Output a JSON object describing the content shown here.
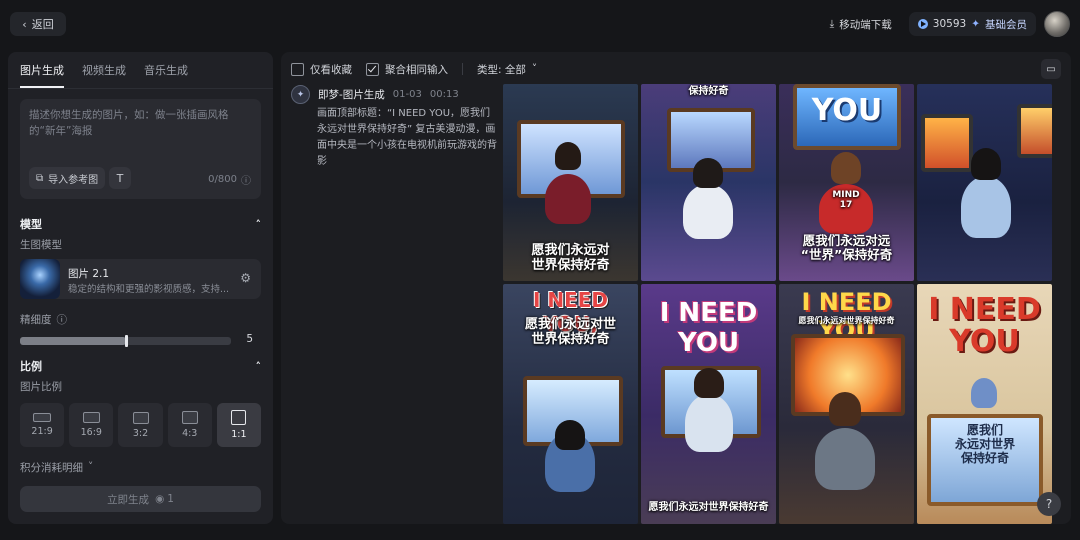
{
  "header": {
    "back_label": "返回",
    "mobile_download": "移动端下载",
    "credits": "30593",
    "membership": "基础会员"
  },
  "left": {
    "tabs": [
      {
        "label": "图片生成",
        "active": true
      },
      {
        "label": "视频生成",
        "active": false
      },
      {
        "label": "音乐生成",
        "active": false
      }
    ],
    "prompt_placeholder": "描述你想生成的图片，如：做一张插画风格的“新年”海报",
    "import_ref": "导入参考图",
    "char_count": "0/800",
    "model_section": "模型",
    "model_sub": "生图模型",
    "model_name": "图片 2.1",
    "model_desc": "稳定的结构和更强的影视质感，支持...",
    "detail_label": "精细度",
    "detail_value": "5",
    "detail_fraction": 0.5,
    "ratio_section": "比例",
    "ratio_sub": "图片比例",
    "ratios": [
      {
        "label": "21:9",
        "active": false
      },
      {
        "label": "16:9",
        "active": false
      },
      {
        "label": "3:2",
        "active": false
      },
      {
        "label": "4:3",
        "active": false
      },
      {
        "label": "1:1",
        "active": true
      }
    ],
    "points_detail": "积分消耗明细",
    "generate_label": "立即生成",
    "generate_cost": "1"
  },
  "right": {
    "filter_favorites": "仅看收藏",
    "filter_merge": "聚合相同输入",
    "filter_type": "类型: 全部",
    "record_title": "即梦-图片生成",
    "record_date": "01-03",
    "record_time": "00:13",
    "record_desc": "画面顶部标题：“I NEED YOU，愿我们永远对世界保持好奇” 复古美漫动漫，画面中央是一个小孩在电视机前玩游戏的背影",
    "tiles": [
      {
        "caption": "愿我们永远对\n世界保持好奇",
        "screen": ""
      },
      {
        "caption": "保持好奇",
        "screen": ""
      },
      {
        "caption": "愿我们永远对远\n“世界”保持好奇",
        "screen": "YOU",
        "shirt": "MIND\n17"
      },
      {
        "caption": "",
        "screen": ""
      },
      {
        "caption": "I NEED YOU,",
        "sub": "愿我们永远对世\n世界保持好奇"
      },
      {
        "caption": "I NEED YOU",
        "sub": "愿我们永远对世界保持好奇"
      },
      {
        "caption": "I NEED YOU",
        "sub": "愿我们永远对世界保持好奇"
      },
      {
        "caption": "I NEED\nYOU",
        "sub": "愿我们\n永远对世界\n保持好奇"
      }
    ]
  }
}
